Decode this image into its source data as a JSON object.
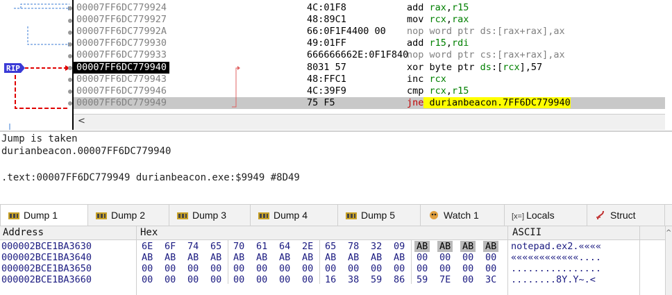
{
  "disasm": {
    "rows": [
      {
        "addr": "00007FF6DC779924",
        "bytes": "4C:01F8",
        "ins": [
          {
            "t": "add "
          },
          {
            "t": "rax",
            "c": "reg"
          },
          {
            "t": ","
          },
          {
            "t": "r15",
            "c": "reg"
          }
        ],
        "style": ""
      },
      {
        "addr": "00007FF6DC779927",
        "bytes": "48:89C1",
        "ins": [
          {
            "t": "mov "
          },
          {
            "t": "rcx",
            "c": "reg"
          },
          {
            "t": ","
          },
          {
            "t": "rax",
            "c": "reg"
          }
        ],
        "style": ""
      },
      {
        "addr": "00007FF6DC77992A",
        "bytes": "66:0F1F4400 00",
        "ins": [
          {
            "t": "nop word ptr ds:[rax+rax],ax"
          }
        ],
        "style": "nop"
      },
      {
        "addr": "00007FF6DC779930",
        "bytes": "49:01FF",
        "ins": [
          {
            "t": "add "
          },
          {
            "t": "r15",
            "c": "reg"
          },
          {
            "t": ","
          },
          {
            "t": "rdi",
            "c": "reg"
          }
        ],
        "style": ""
      },
      {
        "addr": "00007FF6DC779933",
        "bytes": "666666662E:0F1F840",
        "ins": [
          {
            "t": "nop word ptr cs:[rax+rax],ax"
          }
        ],
        "style": "nop"
      },
      {
        "addr": "00007FF6DC779940",
        "bytes": "8031 57",
        "ins": [
          {
            "t": "xor byte ptr "
          },
          {
            "t": "ds",
            "c": "reg"
          },
          {
            "t": ":["
          },
          {
            "t": "rcx",
            "c": "reg"
          },
          {
            "t": "],57"
          }
        ],
        "style": "rip"
      },
      {
        "addr": "00007FF6DC779943",
        "bytes": "48:FFC1",
        "ins": [
          {
            "t": "inc "
          },
          {
            "t": "rcx",
            "c": "reg"
          }
        ],
        "style": ""
      },
      {
        "addr": "00007FF6DC779946",
        "bytes": "4C:39F9",
        "ins": [
          {
            "t": "cmp "
          },
          {
            "t": "rcx",
            "c": "reg"
          },
          {
            "t": ","
          },
          {
            "t": "r15",
            "c": "reg"
          }
        ],
        "style": ""
      },
      {
        "addr": "00007FF6DC779949",
        "bytes": "75 F5",
        "ins": [
          {
            "t": "jne",
            "c": "jne"
          },
          {
            "t": " durianbeacon.7FF6DC779940",
            "c": "hl"
          }
        ],
        "style": "cur"
      }
    ],
    "rip_label": "RIP",
    "scroll_left_glyph": "<"
  },
  "info": {
    "line1": "Jump is taken",
    "line2": "durianbeacon.00007FF6DC779940",
    "line3": ".text:00007FF6DC779949 durianbeacon.exe:$9949 #8D49"
  },
  "tabs": [
    {
      "label": "Dump 1",
      "icon": "dump-icon",
      "active": true
    },
    {
      "label": "Dump 2",
      "icon": "dump-icon"
    },
    {
      "label": "Dump 3",
      "icon": "dump-icon"
    },
    {
      "label": "Dump 4",
      "icon": "dump-icon"
    },
    {
      "label": "Dump 5",
      "icon": "dump-icon"
    },
    {
      "label": "Watch 1",
      "icon": "watch-icon"
    },
    {
      "label": "Locals",
      "icon": "locals-icon",
      "prefix": "[x=]"
    },
    {
      "label": "Struct",
      "icon": "struct-icon"
    }
  ],
  "dump": {
    "headers": {
      "address": "Address",
      "hex": "Hex",
      "ascii": "ASCII"
    },
    "rows": [
      {
        "addr": "000002BCE1BA3630",
        "bytes": [
          "6E",
          "6F",
          "74",
          "65",
          "70",
          "61",
          "64",
          "2E",
          "65",
          "78",
          "32",
          "09",
          "AB",
          "AB",
          "AB",
          "AB"
        ],
        "ascii": "notepad.ex2.««««",
        "sel": [
          12,
          13,
          14,
          15
        ]
      },
      {
        "addr": "000002BCE1BA3640",
        "bytes": [
          "AB",
          "AB",
          "AB",
          "AB",
          "AB",
          "AB",
          "AB",
          "AB",
          "AB",
          "AB",
          "AB",
          "AB",
          "00",
          "00",
          "00",
          "00"
        ],
        "ascii": "««««««««««««....",
        "sel": []
      },
      {
        "addr": "000002BCE1BA3650",
        "bytes": [
          "00",
          "00",
          "00",
          "00",
          "00",
          "00",
          "00",
          "00",
          "00",
          "00",
          "00",
          "00",
          "00",
          "00",
          "00",
          "00"
        ],
        "ascii": "................",
        "sel": []
      },
      {
        "addr": "000002BCE1BA3660",
        "bytes": [
          "00",
          "00",
          "00",
          "00",
          "00",
          "00",
          "00",
          "00",
          "16",
          "38",
          "59",
          "86",
          "59",
          "7E",
          "00",
          "3C"
        ],
        "ascii": "........8Y.Y~.<",
        "sel": []
      }
    ]
  },
  "colors": {
    "rip_badge": "#3a3ad6",
    "jump_arrow": "#e00000",
    "flow_arrow": "#3a7bd5"
  }
}
